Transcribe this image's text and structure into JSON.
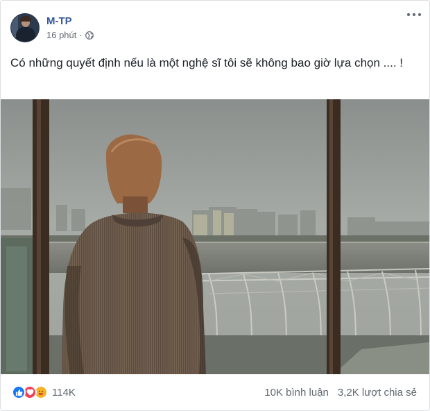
{
  "post": {
    "author": "M-TP",
    "time": "16 phút",
    "separator": "·",
    "privacy_icon": "globe-icon",
    "text": "Có những quyết định nếu là một nghệ sĩ tôi sẽ không bao giờ lựa chọn .... !",
    "photo_icon": "photo-of-man-at-window"
  },
  "footer": {
    "reaction_icons": [
      "like-icon",
      "love-icon",
      "care-icon"
    ],
    "reaction_count": "114K",
    "comments": "10K bình luận",
    "shares": "3,2K lượt chia sẻ"
  },
  "colors": {
    "author_link": "#365899",
    "like": "#1877f2",
    "love": "#f33e58",
    "care": "#f7b125",
    "muted_text": "#606770"
  }
}
